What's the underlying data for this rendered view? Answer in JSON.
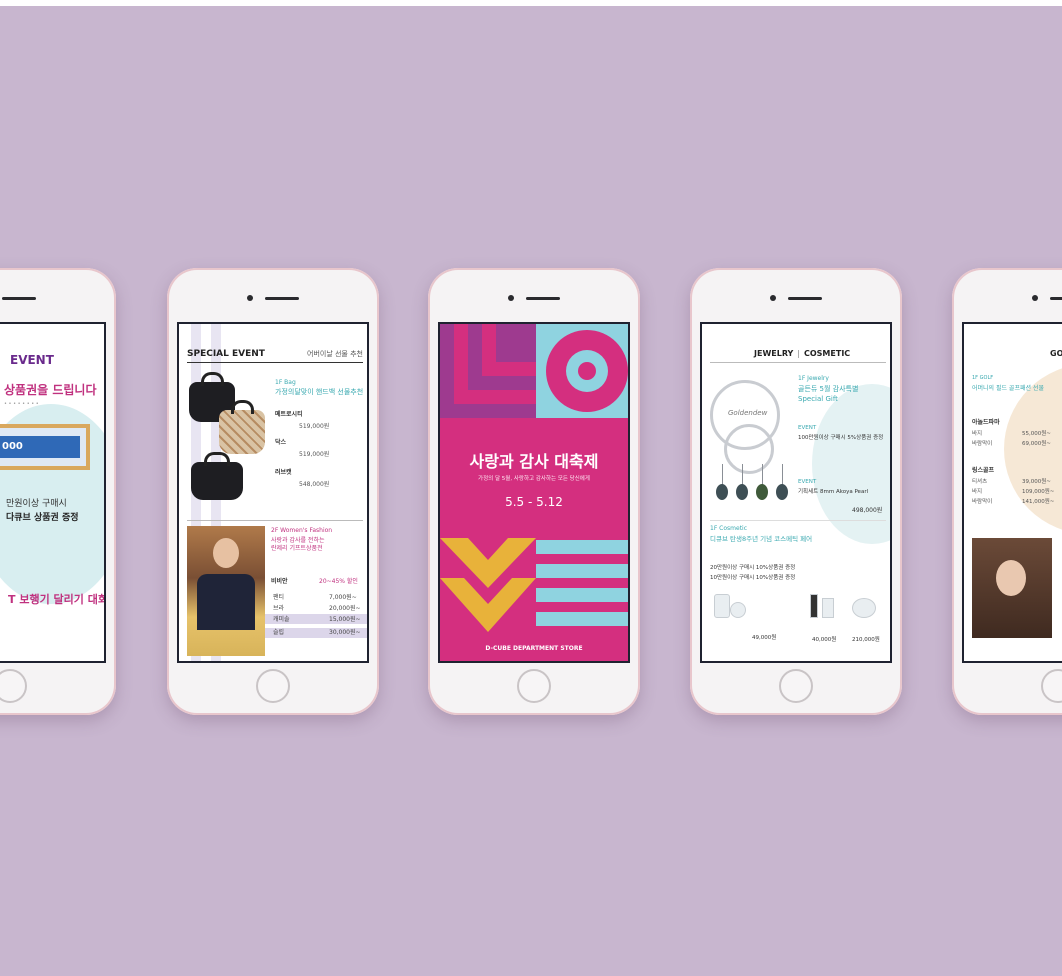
{
  "colors": {
    "background": "#c8b6cf",
    "phone_body": "#f5f3f4",
    "magenta": "#d42f7f",
    "cyan": "#8fd3e0",
    "yellow": "#e8b23a",
    "purple": "#9e3a8f",
    "teal_text": "#3aa9b0"
  },
  "screen1": {
    "title": "EVENT",
    "headline": "상품권을 드립니다",
    "gift_number": "000",
    "line1": "만원이상 구매시",
    "line2": "다큐브 상품권 증정",
    "bottom": "T 보행기 달리기 대회"
  },
  "screen2": {
    "title": "SPECIAL EVENT",
    "subtitle": "어버이날 선물 추천",
    "floor1": "1F Bag",
    "floor1_desc": "가정의달맞이 핸드백 선물추천",
    "brand1": "메트로시티",
    "price1": "519,000원",
    "brand2": "닥스",
    "price2": "519,000원",
    "brand3": "러브캣",
    "price3": "548,000원",
    "floor2": "2F Women's Fashion",
    "floor2_desc1": "사랑과 감사를 전하는",
    "floor2_desc2": "란제리 기프트상품전",
    "brand4": "비비안",
    "discount": "20~45% 할인",
    "list": [
      {
        "name": "팬티",
        "price": "7,000원~"
      },
      {
        "name": "브라",
        "price": "20,000원~"
      },
      {
        "name": "캐미솔",
        "price": "15,000원~"
      },
      {
        "name": "슬립",
        "price": "30,000원~"
      }
    ]
  },
  "screen3": {
    "headline": "사랑과 감사 대축제",
    "subline": "가정의 달 5월, 사랑하고 감사하는 모든 당신에게",
    "dates": "5.5 - 5.12",
    "footer": "D-CUBE DEPARTMENT STORE"
  },
  "screen4": {
    "title_left": "JEWELRY",
    "title_right": "COSMETIC",
    "brand": "Goldendew",
    "floor": "1F Jewelry",
    "desc1": "골든듀 5월 감사특별",
    "desc2": "Special Gift",
    "event1": "EVENT",
    "event1_text": "100만원이상 구매시 5%상품권 증정",
    "event2": "EVENT",
    "event2_text": "기획세트 8mm Akoya Pearl",
    "price_a": "498,000원",
    "floor2": "1F Cosmetic",
    "floor2_desc": "디큐브 탄생8주년 기념 코스메틱 페어",
    "promo1": "20만원이상 구매시 10%상품권 증정",
    "promo2": "10만원이상 구매시 10%상품권 증정",
    "price_b": "49,000원",
    "price_c": "40,000원",
    "price_d": "210,000원"
  },
  "screen5": {
    "title": "GOL",
    "floor": "1F GOLF",
    "desc": "어머니의 필드 골프패션 선물",
    "brand1": "아놀드파마",
    "row1_label": "바지",
    "row1_price": "55,000원~",
    "row2_label": "바람막이",
    "row2_price": "69,000원~",
    "brand2": "링스골프",
    "row3_label": "티셔츠",
    "row3_price": "39,000원~",
    "row4_label": "바지",
    "row4_price": "109,000원~",
    "row5_label": "바람막이",
    "row5_price": "141,000원~"
  }
}
